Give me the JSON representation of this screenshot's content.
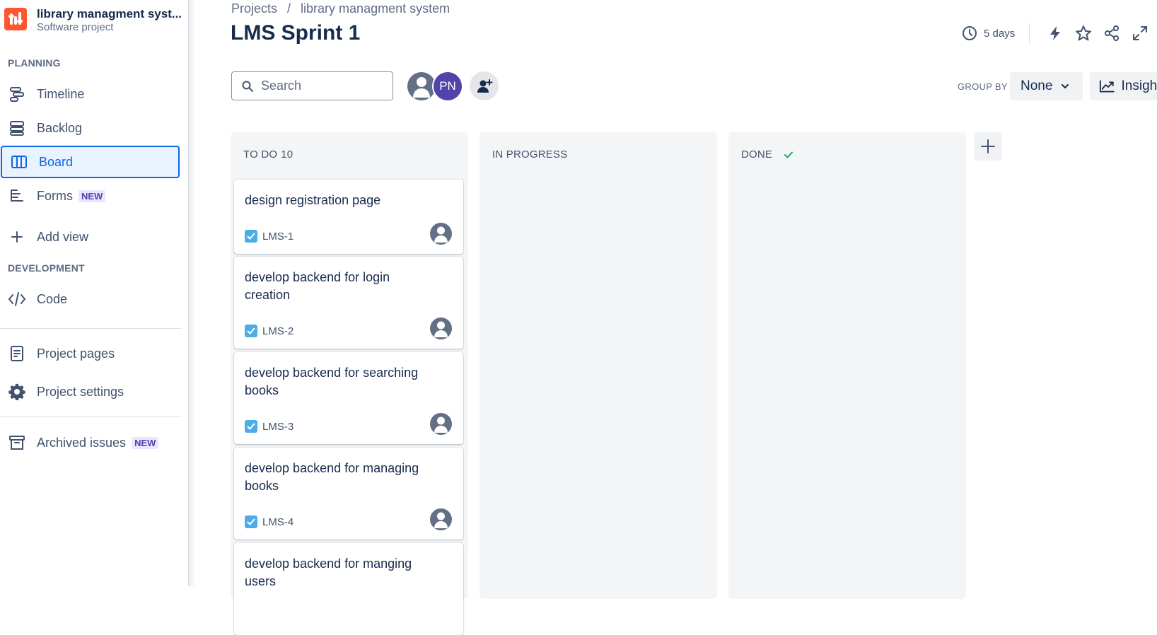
{
  "project": {
    "name": "library managment syst...",
    "type": "Software project"
  },
  "sidebar": {
    "planning_title": "PLANNING",
    "development_title": "DEVELOPMENT",
    "new_badge": "NEW",
    "items": {
      "timeline": "Timeline",
      "backlog": "Backlog",
      "board": "Board",
      "forms": "Forms",
      "add_view": "Add view",
      "code": "Code",
      "project_pages": "Project pages",
      "project_settings": "Project settings",
      "archived_issues": "Archived issues"
    }
  },
  "breadcrumb": {
    "root": "Projects",
    "separator": "/",
    "project": "library managment system"
  },
  "page_title": "LMS Sprint 1",
  "header": {
    "sprint_remaining": "5 days"
  },
  "toolbar": {
    "search_placeholder": "Search",
    "avatar_initials": "PN",
    "group_by_label": "GROUP BY",
    "group_by_value": "None",
    "insights_label": "Insights"
  },
  "board": {
    "columns": [
      {
        "name": "TO DO",
        "count": "10"
      },
      {
        "name": "IN PROGRESS",
        "count": ""
      },
      {
        "name": "DONE",
        "count": ""
      }
    ],
    "cards": [
      {
        "title": "design registration page",
        "key": "LMS-1"
      },
      {
        "title": "develop backend for login creation",
        "key": "LMS-2"
      },
      {
        "title": "develop backend for searching books",
        "key": "LMS-3"
      },
      {
        "title": "develop backend for managing books",
        "key": "LMS-4"
      },
      {
        "title": "develop backend for manging users",
        "key": ""
      }
    ]
  },
  "colors": {
    "accent": "#0c66e4",
    "project_logo": "#ff5630",
    "avatar_pn": "#5243aa",
    "done_check": "#22a06b",
    "task_icon": "#4bade8"
  }
}
